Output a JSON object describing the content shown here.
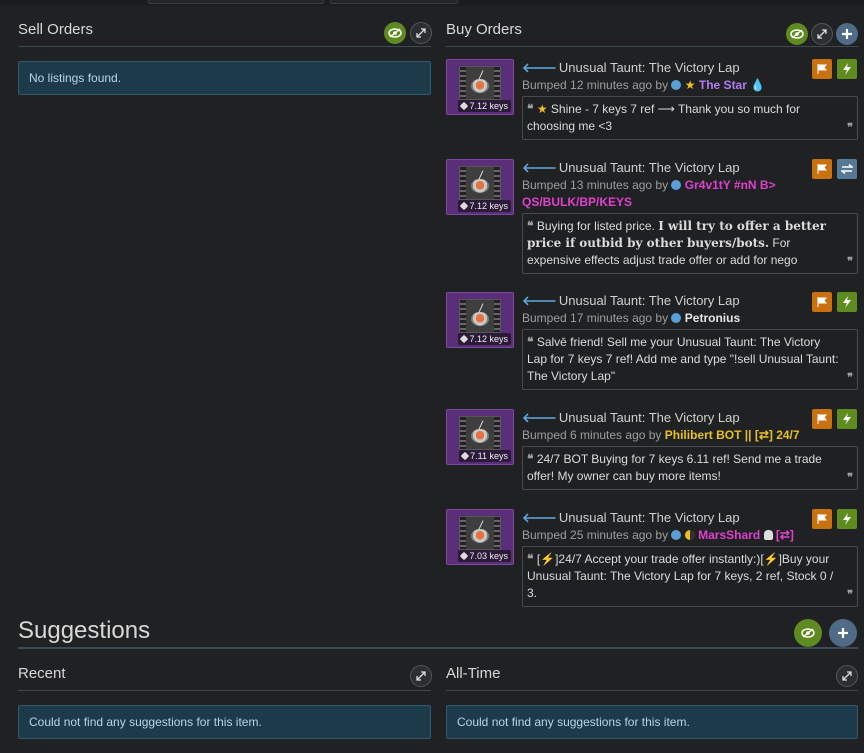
{
  "sell": {
    "title": "Sell Orders",
    "empty": "No listings found."
  },
  "buy": {
    "title": "Buy Orders",
    "orders": [
      {
        "item": "Unusual Taunt: The Victory Lap",
        "price": "7.12 keys",
        "bumped": "Bumped 12 minutes ago by",
        "user": "The Star",
        "user_color": "#b07cf0",
        "message": "Shine - 7 keys 7 ref ⟶ Thank you so much for choosing me <3",
        "action": "lightning"
      },
      {
        "item": "Unusual Taunt: The Victory Lap",
        "price": "7.12 keys",
        "bumped": "Bumped 13 minutes ago by",
        "user": "Gr4v1tY #nN B> QS/BULK/BP/KEYS",
        "user_color": "#e040d0",
        "message_a": "Buying for listed price. ",
        "message_b": "I will try to offer a better price if outbid by other buyers/bots.",
        "message_c": " For expensive effects adjust trade offer or add for nego",
        "action": "trade"
      },
      {
        "item": "Unusual Taunt: The Victory Lap",
        "price": "7.12 keys",
        "bumped": "Bumped 17 minutes ago by",
        "user": "Petronius",
        "user_color": "#d6d6d6",
        "message": "Salvē friend! Sell me your Unusual Taunt: The Victory Lap for 7 keys 7 ref! Add me and type \"!sell Unusual Taunt: The Victory Lap\"",
        "action": "lightning"
      },
      {
        "item": "Unusual Taunt: The Victory Lap",
        "price": "7.11 keys",
        "bumped": "Bumped 6 minutes ago by",
        "user": "Philibert BOT || [⇄] 24/7",
        "user_color": "#e8c020",
        "message": "24/7 BOT Buying for 7 keys 6.11 ref! Send me a trade offer! My owner can buy more items!",
        "action": "lightning"
      },
      {
        "item": "Unusual Taunt: The Victory Lap",
        "price": "7.03 keys",
        "bumped": "Bumped 25 minutes ago by",
        "user": "MarsShard",
        "user_tag": "[⇄]",
        "user_color": "#e040d0",
        "message": "[⚡]24/7 Accept your trade offer instantly:)[⚡]Buy your Unusual Taunt: The Victory Lap for 7 keys, 2 ref, Stock 0 / 3.",
        "action": "lightning"
      }
    ]
  },
  "suggestions": {
    "title": "Suggestions",
    "recent_title": "Recent",
    "alltime_title": "All-Time",
    "recent_empty": "Could not find any suggestions for this item.",
    "alltime_empty": "Could not find any suggestions for this item."
  },
  "colors": {
    "accent_green": "#5e8a22",
    "accent_blue": "#4f6b86",
    "orange": "#c8710e",
    "info_bg": "#1d3a4b"
  }
}
